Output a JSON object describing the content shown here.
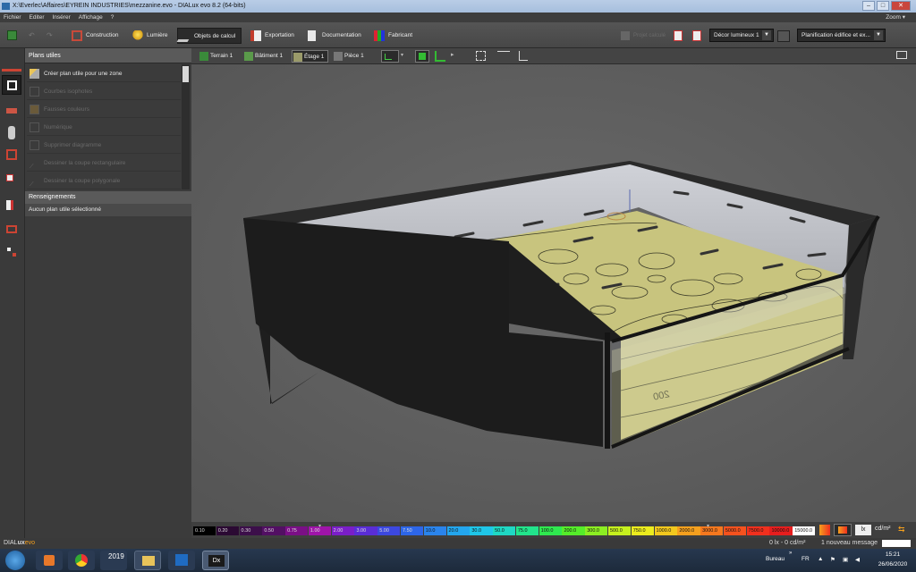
{
  "window": {
    "title": "X:\\Everlec\\Affaires\\EYREIN INDUSTRIES\\mezzanine.evo - DIALux evo 8.2  (64-bits)"
  },
  "menu": {
    "items": [
      "Fichier",
      "Editer",
      "Insérer",
      "Affichage",
      "?"
    ],
    "zoom_label": "Zoom"
  },
  "toolbar": {
    "modes": [
      {
        "label": "Construction",
        "active": false
      },
      {
        "label": "Lumière",
        "active": false
      },
      {
        "label": "Objets de calcul",
        "active": true
      },
      {
        "label": "Exportation",
        "active": false
      },
      {
        "label": "Documentation",
        "active": false
      },
      {
        "label": "Fabricant",
        "active": false
      }
    ],
    "greyed_label": "Projet calculé",
    "dropdown1": "Décor lumineux 1",
    "dropdown2": "Planification édifice et ex..."
  },
  "panel": {
    "header": "Plans utiles",
    "items": [
      {
        "label": "Créer plan utile pour une zone",
        "enabled": true
      },
      {
        "label": "Courbes isophotes",
        "enabled": false
      },
      {
        "label": "Fausses couleurs",
        "enabled": false
      },
      {
        "label": "Numérique",
        "enabled": false
      },
      {
        "label": "Supprimer diagramme",
        "enabled": false
      },
      {
        "label": "Dessiner la coupe rectangulaire",
        "enabled": false
      },
      {
        "label": "Dessiner la coupe polygonale",
        "enabled": false
      }
    ],
    "info_header": "Renseignements",
    "info_text": "Aucun plan utile sélectionné"
  },
  "viewbar": {
    "terrain": "Terrain 1",
    "batiment": "Bâtiment 1",
    "etage": "Étage 1",
    "piece": "Pièce 1"
  },
  "scene": {
    "contour_label": "200"
  },
  "legend": {
    "values": [
      "0.10",
      "0.20",
      "0.30",
      "0.50",
      "0.75",
      "1.00",
      "2.00",
      "3.00",
      "5.00",
      "7.50",
      "10.0",
      "20.0",
      "30.0",
      "50.0",
      "75.0",
      "100.0",
      "200.0",
      "300.0",
      "500.0",
      "750.0",
      "1000.0",
      "2000.0",
      "3000.0",
      "5000.0",
      "7500.0",
      "10000.0",
      "15000.0"
    ],
    "colors": [
      "#000000",
      "#2b0a33",
      "#3c0f4a",
      "#520f63",
      "#7a0f86",
      "#9f14a9",
      "#7a1ec8",
      "#5a2dd6",
      "#3c48e0",
      "#2d66e8",
      "#2a84ec",
      "#23a6ee",
      "#1fc6e8",
      "#1fd8c4",
      "#22e48c",
      "#2fe84f",
      "#55ec2a",
      "#8cee22",
      "#c6f01e",
      "#ecec1e",
      "#f2c81e",
      "#f5a01e",
      "#f6781e",
      "#f5521e",
      "#f0301e",
      "#e61e1e",
      "#ffffff"
    ],
    "unit_lx": "lx",
    "unit_cd": "cd/m²"
  },
  "status": {
    "app_name_1": "DIAL",
    "app_name_2": "ux",
    "app_name_3": "evo",
    "measure": "0 lx - 0 cd/m²",
    "messages": "1 nouveau message"
  },
  "taskbar": {
    "desktop": "Bureau",
    "lang": "FR",
    "time": "15:21",
    "date": "26/06/2020",
    "dialux_version": "2019"
  }
}
